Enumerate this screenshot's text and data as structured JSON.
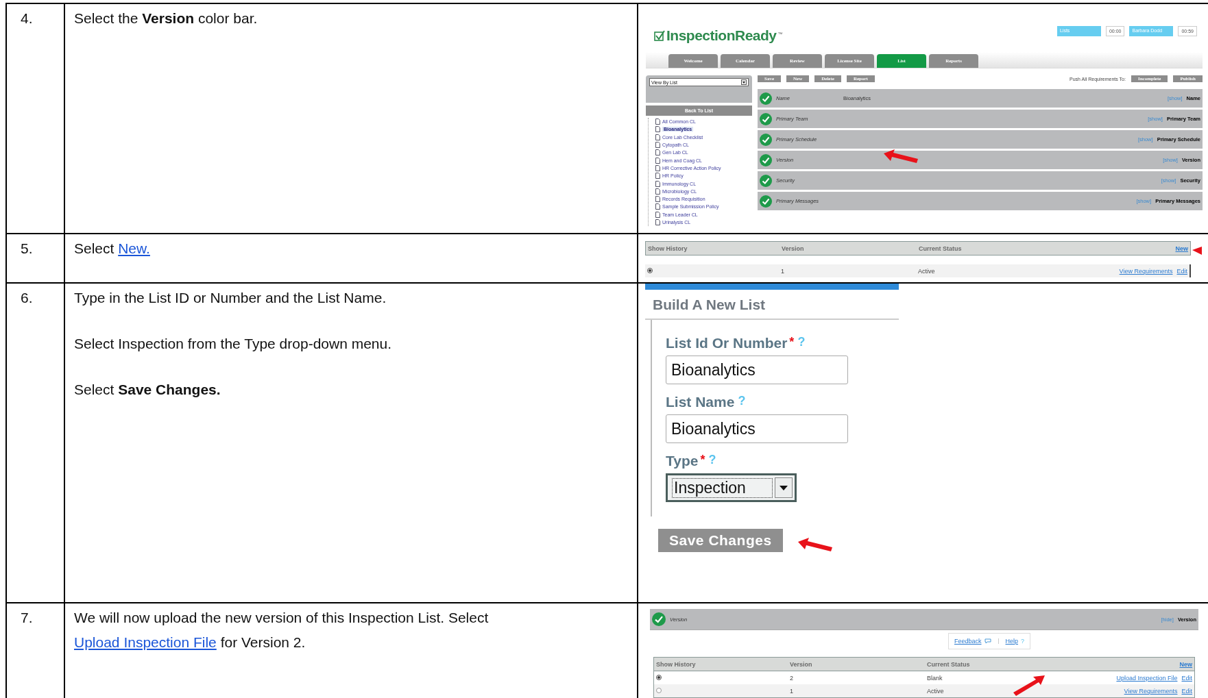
{
  "steps": [
    {
      "number": "4.",
      "paragraphs": [
        [
          {
            "text": "Select the **Version** color bar.",
            "link": false
          }
        ]
      ],
      "screenshot": {
        "kind": "app_overview",
        "logo": "InspectionReady",
        "logo_mark": "™",
        "header_fields": [
          {
            "kind": "field",
            "text": "Lists"
          },
          {
            "kind": "timer",
            "text": "00:00"
          },
          {
            "kind": "field",
            "text": "Barbara Dodd"
          },
          {
            "kind": "timer",
            "text": "00:59"
          }
        ],
        "tabs": [
          {
            "label": "Welcome",
            "selected": false
          },
          {
            "label": "Calendar",
            "selected": false
          },
          {
            "label": "Review",
            "selected": false
          },
          {
            "label": "License Site",
            "selected": false
          },
          {
            "label": "List",
            "selected": true
          },
          {
            "label": "Reports",
            "selected": false
          }
        ],
        "view_select": "View By List",
        "back_button": "Back To List",
        "tree": [
          {
            "label": "All Common CL",
            "selected": false
          },
          {
            "label": "Bioanalytics",
            "selected": true
          },
          {
            "label": "Core Lab Checklist",
            "selected": false
          },
          {
            "label": "Cytopath CL",
            "selected": false
          },
          {
            "label": "Gen Lab CL",
            "selected": false
          },
          {
            "label": "Hem and Coag CL",
            "selected": false
          },
          {
            "label": "HR Corrective Action Policy",
            "selected": false
          },
          {
            "label": "HR Policy",
            "selected": false
          },
          {
            "label": "Immunology CL",
            "selected": false
          },
          {
            "label": "Microbiology CL",
            "selected": false
          },
          {
            "label": "Records Requisition",
            "selected": false
          },
          {
            "label": "Sample Submission Policy",
            "selected": false
          },
          {
            "label": "Team Leader CL",
            "selected": false
          },
          {
            "label": "Urinalysis CL",
            "selected": false
          }
        ],
        "toolbar": [
          "Save",
          "New",
          "Delete",
          "Report"
        ],
        "push_label": "Push All Requirements To:",
        "push_buttons": [
          "Incomplete",
          "Publish"
        ],
        "sections": [
          {
            "label": "Name",
            "value": "Bioanalytics",
            "action": "[show]",
            "title": "Name"
          },
          {
            "label": "Primary Team",
            "action": "[show]",
            "title": "Primary Team"
          },
          {
            "label": "Primary Schedule",
            "action": "[show]",
            "title": "Primary Schedule"
          },
          {
            "label": "Version",
            "action": "[show]",
            "title": "Version"
          },
          {
            "label": "Security",
            "action": "[show]",
            "title": "Security"
          },
          {
            "label": "Primary Messages",
            "action": "[show]",
            "title": "Primary Messages"
          }
        ]
      }
    },
    {
      "number": "5.",
      "paragraphs": [
        [
          {
            "text": "Select ",
            "link": false
          },
          {
            "text": "New.",
            "link": true
          }
        ]
      ],
      "screenshot": {
        "kind": "history_table",
        "columns": [
          "Show History",
          "Version",
          "Current Status"
        ],
        "new_link": "New",
        "rows": [
          {
            "selected": true,
            "version": "1",
            "status": "Active",
            "links": [
              "View Requirements",
              "Edit"
            ]
          }
        ]
      }
    },
    {
      "number": "6.",
      "paragraphs": [
        [
          {
            "text": "Type in the List ID or Number and the List Name.",
            "link": false
          }
        ],
        [
          {
            "text": "Select Inspection from the Type drop-down menu.",
            "link": false
          }
        ],
        [
          {
            "text": "Select **Save Changes.**",
            "link": false
          }
        ]
      ],
      "screenshot": {
        "kind": "new_list_form",
        "title": "Build A New List",
        "fields": [
          {
            "kind": "text",
            "label": "List Id Or Number",
            "required_mark": "*",
            "help_mark": "?",
            "value": "Bioanalytics"
          },
          {
            "kind": "text",
            "label": "List Name",
            "help_mark": "?",
            "value": "Bioanalytics"
          },
          {
            "kind": "select",
            "label": "Type",
            "required_mark": "*",
            "help_mark": "?",
            "value": "Inspection"
          }
        ],
        "save_button": {
          "label": "Save Changes",
          "disabled": true
        }
      }
    },
    {
      "number": "7.",
      "paragraphs": [
        [
          {
            "text": "We will now upload the new version of this Inspection List.  Select ",
            "link": false
          },
          {
            "text": "Upload Inspection File",
            "link": true
          },
          {
            "text": " for Version 2.",
            "link": false
          }
        ]
      ],
      "screenshot": {
        "kind": "version_panel",
        "label": "Version",
        "action": "[hide]",
        "title": "Version",
        "feedback": "Feedback",
        "help": "Help",
        "help_mark": "?",
        "columns": [
          "Show History",
          "Version",
          "Current Status"
        ],
        "new_link": "New",
        "rows": [
          {
            "selected": true,
            "version": "2",
            "status": "Blank",
            "links": [
              "Upload Inspection File",
              "Edit"
            ]
          },
          {
            "selected": false,
            "version": "1",
            "status": "Active",
            "links": [
              "View Requirements",
              "Edit"
            ]
          }
        ]
      }
    }
  ]
}
